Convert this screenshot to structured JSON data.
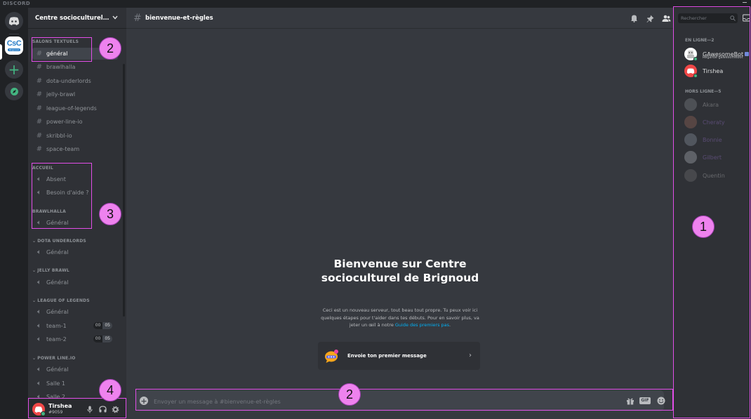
{
  "app": {
    "brand": "DISCORD"
  },
  "server": {
    "name": "Centre socioculturel de Brignoud",
    "logo_text": "CsC",
    "logo_sub": "Brignoud"
  },
  "sidebar": {
    "categories": {
      "text": "SALONS TEXTUELS",
      "accueil": "ACCUEIL",
      "brawlhalla": "BRAWLHALLA",
      "dota": "DOTA UNDERLORDS",
      "jelly": "JELLY BRAWL",
      "lol": "LEAGUE OF LEGENDS",
      "powerline": "POWER LINE.IO"
    },
    "text_channels": [
      "général",
      "brawlhalla",
      "dota-underlords",
      "jelly-brawl",
      "league-of-legends",
      "power-line-io",
      "skribbl-io",
      "space-team"
    ],
    "voice": {
      "accueil_absent": "Absent",
      "accueil_aide": "Besoin d'aide ?",
      "brawlhalla_general": "Général",
      "dota_general": "Général",
      "jelly_general": "Général",
      "lol_general": "Général",
      "lol_team1": "team-1",
      "lol_team2": "team-2",
      "pl_general": "Général",
      "pl_salle1": "Salle 1",
      "pl_salle2": "Salle 2"
    },
    "counts": {
      "team1_a": "00",
      "team1_b": "05",
      "team2_a": "00",
      "team2_b": "05"
    }
  },
  "user": {
    "name": "Tirshea",
    "tag": "#9059"
  },
  "chat": {
    "channel": "bienvenue-et-règles",
    "welcome_title": "Bienvenue sur Centre socioculturel de Brignoud",
    "welcome_desc": "Ceci est un nouveau serveur, tout beau tout propre. Tu peux voir ici quelques étapes pour t'aider dans tes débuts. Pour en savoir plus, va jeter un œil à notre ",
    "welcome_link": "Guide des premiers pas",
    "welcome_end": ".",
    "first_message": "Envoie ton premier message",
    "composer_placeholder": "Envoyer un message à #bienvenue-et-règles",
    "gif": "GIF"
  },
  "members": {
    "search_placeholder": "Rechercher",
    "online_header": "EN LIGNE—2",
    "offline_header": "HORS LIGNE—5",
    "online": [
      {
        "name": "GAwesomeBot",
        "sub": "Regarde gawesomebot"
      },
      {
        "name": "Tirshea"
      }
    ],
    "offline": [
      "Akara",
      "Cheraty",
      "Bonnie",
      "Gilbert",
      "Quentin"
    ]
  },
  "annotations": {
    "n1": "1",
    "n2a": "2",
    "n2b": "2",
    "n3": "3",
    "n4": "4"
  },
  "colors": {
    "accent": "#7289da",
    "online": "#43b581",
    "annotation": "#ee82ee",
    "link": "#00b0f4"
  }
}
